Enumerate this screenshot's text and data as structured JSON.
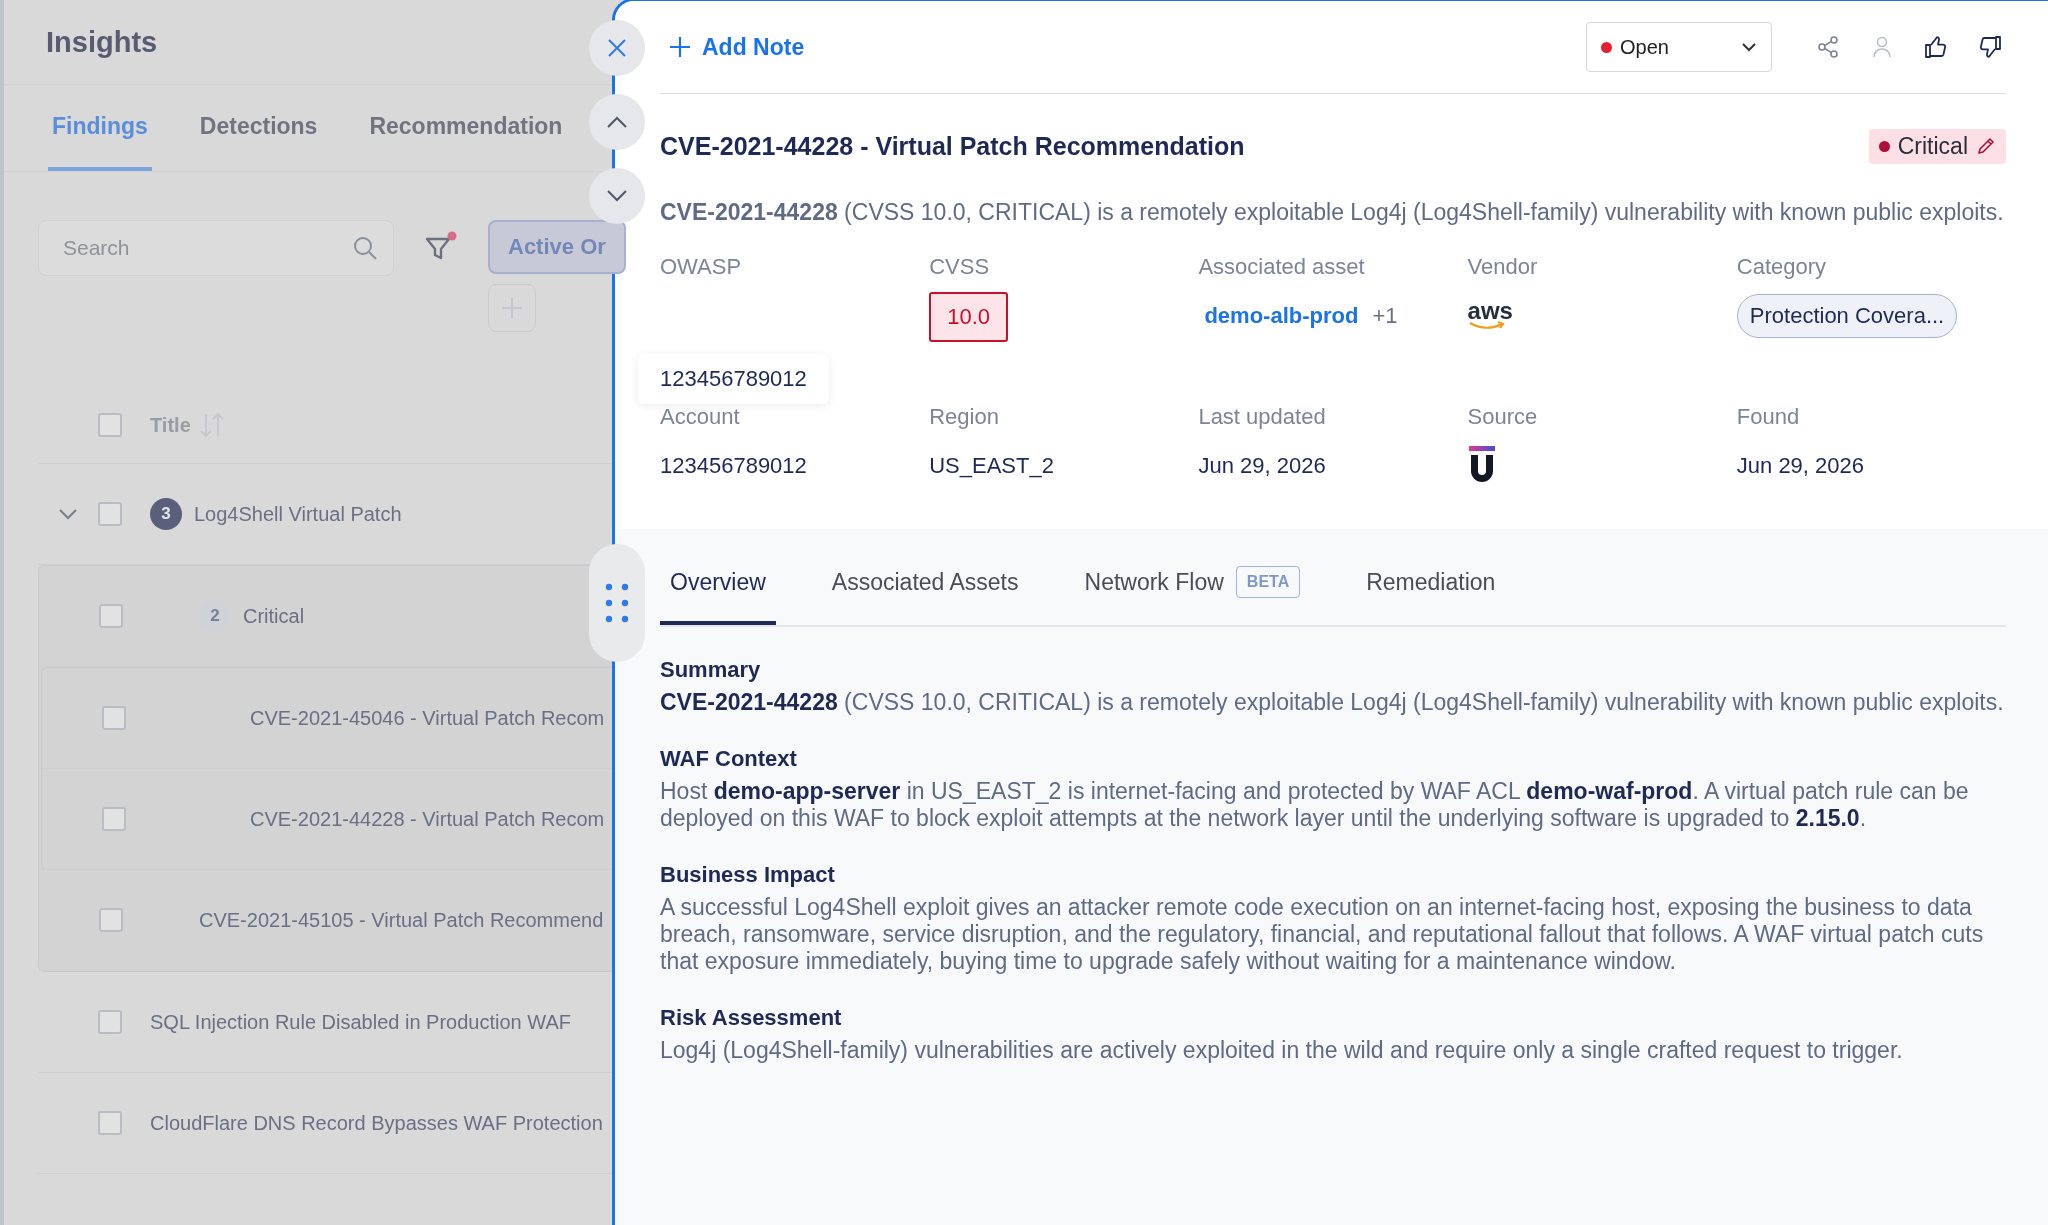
{
  "sidebar": {
    "title": "Insights",
    "tabs": [
      {
        "label": "Findings",
        "selected": true
      },
      {
        "label": "Detections",
        "selected": false
      },
      {
        "label": "Recommendation",
        "selected": false
      }
    ],
    "search": {
      "placeholder": "Search"
    },
    "filter_active": true,
    "active_filter": "Active Or",
    "table": {
      "columns": [
        "Title"
      ],
      "select_all_checked": false,
      "rows": [
        {
          "title": "Log4Shell Virtual Patch",
          "count": "3",
          "checked": false,
          "expanded": true,
          "children": [
            {
              "title": "Critical",
              "count": "2",
              "checked": false,
              "children": [
                {
                  "title": "CVE-2021-45046 - Virtual Patch Recom",
                  "checked": false
                },
                {
                  "title": "CVE-2021-44228 - Virtual Patch Recom",
                  "checked": false
                }
              ]
            },
            {
              "title": "CVE-2021-45105 - Virtual Patch Recommend",
              "checked": false
            }
          ]
        },
        {
          "title": "SQL Injection Rule Disabled in Production WAF",
          "checked": false
        },
        {
          "title": "CloudFlare DNS Record Bypasses WAF Protection",
          "checked": false
        }
      ]
    }
  },
  "drawer": {
    "add_note": "Add Note",
    "status": {
      "value": "Open",
      "color": "#e5202e"
    },
    "title": "CVE-2021-44228 - Virtual Patch Recommendation",
    "severity": {
      "label": "Critical",
      "color": "#b0103a"
    },
    "description": "**CVE-2021-44228** (CVSS 10.0, CRITICAL) is a remotely exploitable Log4j (Log4Shell-family) vulnerability with known public exploits.",
    "fields": [
      {
        "label": "OWASP",
        "kind": "empty"
      },
      {
        "label": "CVSS",
        "kind": "score",
        "value": "10.0"
      },
      {
        "label": "Associated asset",
        "kind": "link",
        "value": "demo-alb-prod",
        "extra": "+1"
      },
      {
        "label": "Vendor",
        "kind": "vendor",
        "value": "aws"
      },
      {
        "label": "Category",
        "kind": "pill",
        "value": "Protection Covera..."
      },
      {
        "label": "Account",
        "kind": "text",
        "value": "123456789012"
      },
      {
        "label": "Region",
        "kind": "text",
        "value": "US_EAST_2"
      },
      {
        "label": "Last updated",
        "kind": "text",
        "value": "Jun 29, 2026"
      },
      {
        "label": "Source",
        "kind": "source-logo"
      },
      {
        "label": "Found",
        "kind": "text",
        "value": "Jun 29, 2026"
      }
    ],
    "tooltip": "123456789012",
    "tabs": [
      {
        "label": "Overview",
        "selected": true
      },
      {
        "label": "Associated Assets",
        "selected": false
      },
      {
        "label": "Network Flow",
        "selected": false,
        "badge": "BETA"
      },
      {
        "label": "Remediation",
        "selected": false
      }
    ],
    "sections": [
      {
        "heading": "Summary",
        "body": "**CVE-2021-44228** (CVSS 10.0, CRITICAL) is a remotely exploitable Log4j (Log4Shell-family) vulnerability with known public exploits."
      },
      {
        "heading": "WAF Context",
        "body": "Host **demo-app-server** in US_EAST_2 is internet-facing and protected by WAF ACL **demo-waf-prod**. A virtual patch rule can be deployed on this WAF to block exploit attempts at the network layer until the underlying software is upgraded to **2.15.0**."
      },
      {
        "heading": "Business Impact",
        "body": "A successful Log4Shell exploit gives an attacker remote code execution on an internet-facing host, exposing the business to data breach, ransomware, service disruption, and the regulatory, financial, and reputational fallout that follows. A WAF virtual patch cuts that exposure immediately, buying time to upgrade safely without waiting for a maintenance window."
      },
      {
        "heading": "Risk Assessment",
        "body": "Log4j (Log4Shell-family) vulnerabilities are actively exploited in the wild and require only a single crafted request to trigger."
      }
    ]
  }
}
